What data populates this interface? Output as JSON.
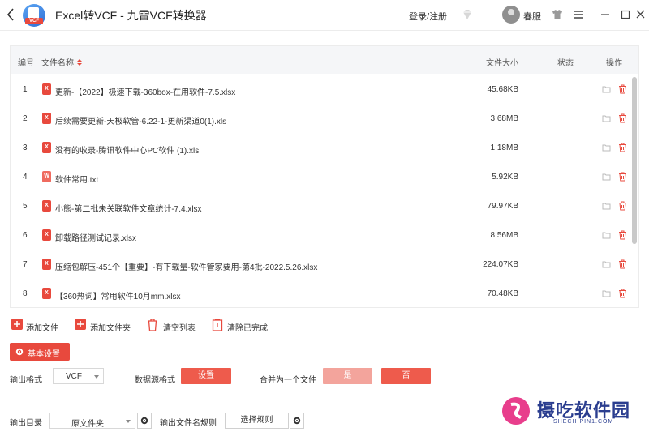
{
  "window": {
    "title": "Excel转VCF - 九雷VCF转换器",
    "logo_tag": "VCF",
    "login_label": "登录/注册",
    "username": "春服"
  },
  "table": {
    "headers": {
      "no": "编号",
      "name": "文件名称",
      "size": "文件大小",
      "status": "状态",
      "ops": "操作"
    },
    "rows": [
      {
        "no": "1",
        "type": "X",
        "name": "更新-【2022】极速下载-360box-在用软件-7.5.xlsx",
        "size": "45.68KB",
        "status": ""
      },
      {
        "no": "2",
        "type": "X",
        "name": "后续需要更新-天极软管-6.22-1-更新渠道0(1).xls",
        "size": "3.68MB",
        "status": ""
      },
      {
        "no": "3",
        "type": "X",
        "name": "没有的收录-腾讯软件中心PC软件 (1).xls",
        "size": "1.18MB",
        "status": ""
      },
      {
        "no": "4",
        "type": "W",
        "name": "软件常用.txt",
        "size": "5.92KB",
        "status": ""
      },
      {
        "no": "5",
        "type": "X",
        "name": "小熊-第二批未关联软件文章统计-7.4.xlsx",
        "size": "79.97KB",
        "status": ""
      },
      {
        "no": "6",
        "type": "X",
        "name": "卸载路径测试记录.xlsx",
        "size": "8.56MB",
        "status": ""
      },
      {
        "no": "7",
        "type": "X",
        "name": "压缩包解压-451个【重要】-有下载量-软件管家要用-第4批-2022.5.26.xlsx",
        "size": "224.07KB",
        "status": ""
      },
      {
        "no": "8",
        "type": "X",
        "name": "【360热词】常用软件10月mm.xlsx",
        "size": "70.48KB",
        "status": ""
      }
    ]
  },
  "actions": {
    "add_file": "添加文件",
    "add_folder": "添加文件夹",
    "clear_list": "清空列表",
    "clear_done": "清除已完成"
  },
  "settings": {
    "button_label": "基本设置",
    "output_format_label": "输出格式",
    "output_format_value": "VCF",
    "source_format_label": "数据源格式",
    "source_format_button": "设置",
    "merge_label": "合并为一个文件",
    "merge_yes": "是",
    "merge_no": "否",
    "output_dir_label": "输出目录",
    "output_dir_value": "原文件夹",
    "name_rule_label": "输出文件名规则",
    "name_rule_button": "选择规则"
  },
  "watermark": {
    "cn": "摄吃软件园",
    "en": "SHECHIPIN1.COM"
  },
  "colors": {
    "accent": "#e8493d",
    "accent_light": "#f3a49c",
    "header_bg": "#f5f6f8"
  }
}
